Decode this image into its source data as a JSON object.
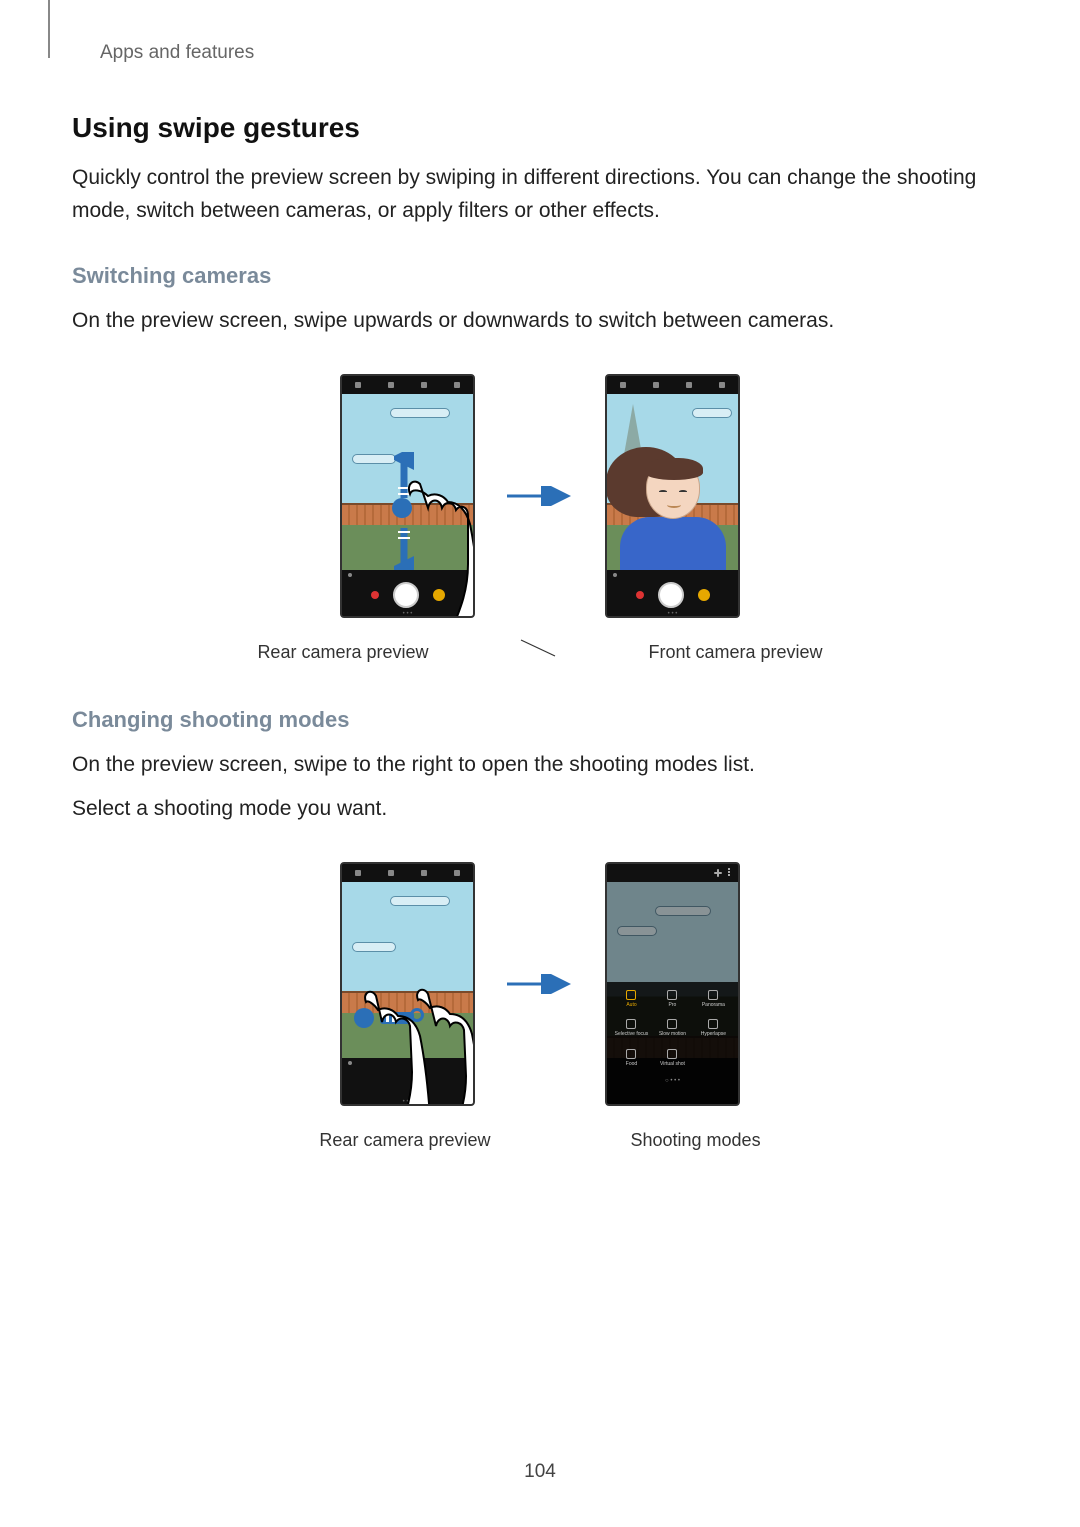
{
  "breadcrumb": "Apps and features",
  "h1": "Using swipe gestures",
  "intro": "Quickly control the preview screen by swiping in different directions. You can change the shooting mode, switch between cameras, or apply filters or other effects.",
  "section1": {
    "title": "Switching cameras",
    "text": "On the preview screen, swipe upwards or downwards to switch between cameras.",
    "caption_left": "Rear camera preview",
    "caption_right": "Front camera preview"
  },
  "section2": {
    "title": "Changing shooting modes",
    "text1": "On the preview screen, swipe to the right to open the shooting modes list.",
    "text2": "Select a shooting mode you want.",
    "caption_left": "Rear camera preview",
    "caption_right": "Shooting modes",
    "modes": [
      "Auto",
      "Pro",
      "Panorama",
      "Selective focus",
      "Slow motion",
      "Hyperlapse",
      "Food",
      "Virtual shot"
    ]
  },
  "page_number": "104"
}
